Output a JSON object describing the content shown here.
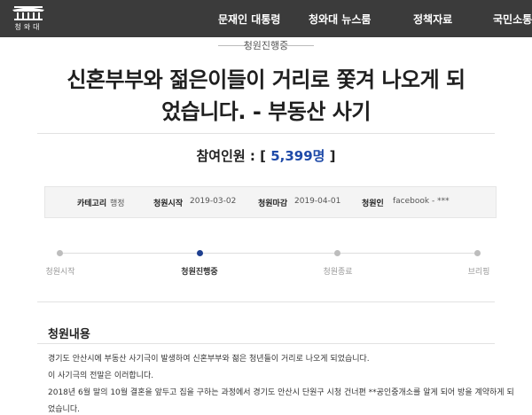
{
  "nav": {
    "logo_text": "청와대",
    "items": [
      "문재인 대통령",
      "청와대 뉴스룸",
      "정책자료",
      "국민소통"
    ]
  },
  "petition": {
    "status": "청원진행중",
    "title_line1": "신혼부부와 젊은이들이 거리로 쫓겨 나오게 되",
    "title_line2": "었습니다. - 부동산 사기",
    "participants_label": "참여인원 : [ ",
    "participants_count": "5,399명",
    "participants_suffix": " ]"
  },
  "info": {
    "category_label": "카테고리",
    "category_value": "행정",
    "start_label": "청원시작",
    "start_value": "2019-03-02",
    "end_label": "청원마감",
    "end_value": "2019-04-01",
    "author_label": "청원인",
    "author_value": "facebook - ***"
  },
  "progress": {
    "steps": [
      "청원시작",
      "청원진행중",
      "청원종료",
      "브리핑"
    ],
    "active_index": 1
  },
  "content": {
    "heading": "청원내용",
    "lines": [
      "경기도 안산시에 부동산 사기극이 발생하여 신혼부부와 젊은 청년들이 거리로 나오게 되었습니다.",
      "이 사기극의 전말은 이러합니다.",
      "2018년 6월 말의 10월 결혼을 앞두고 집을 구하는 과정에서 경기도 안산시 단원구 시청 건너편 **공인중개소를 알게 되어 방을 계약하게 되",
      "었습니다."
    ]
  },
  "colors": {
    "nav_bg": "#3b3b3b",
    "accent": "#1e4aa8",
    "active_dot": "#1e3f8f"
  }
}
